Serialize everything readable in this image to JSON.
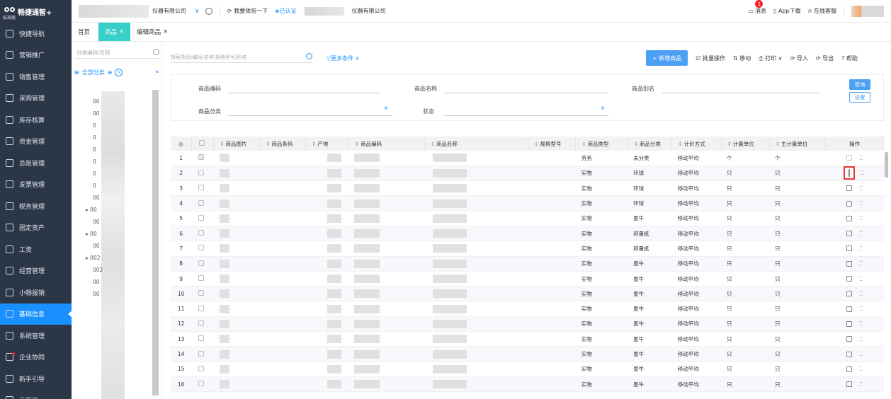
{
  "brand": {
    "name": "畅捷通智+",
    "version": "标准版"
  },
  "sidebar": {
    "items": [
      {
        "label": "快捷导航",
        "icon": "home-icon"
      },
      {
        "label": "营销推广",
        "icon": "gift-icon"
      },
      {
        "label": "销售管理",
        "icon": "sales-icon"
      },
      {
        "label": "采购管理",
        "icon": "purchase-icon"
      },
      {
        "label": "库存核算",
        "icon": "warehouse-icon"
      },
      {
        "label": "资金管理",
        "icon": "money-icon"
      },
      {
        "label": "总账管理",
        "icon": "ledger-icon"
      },
      {
        "label": "发票管理",
        "icon": "invoice-icon"
      },
      {
        "label": "税务管理",
        "icon": "tax-icon"
      },
      {
        "label": "固定资产",
        "icon": "asset-icon"
      },
      {
        "label": "工资",
        "icon": "salary-icon"
      },
      {
        "label": "经营管理",
        "icon": "business-icon"
      },
      {
        "label": "小畅报销",
        "icon": "reimburse-icon"
      },
      {
        "label": "基础信息",
        "icon": "basic-info-icon",
        "active": true
      },
      {
        "label": "系统管理",
        "icon": "system-icon"
      },
      {
        "label": "企业协同",
        "icon": "collab-icon",
        "dot": true
      },
      {
        "label": "新手引导",
        "icon": "guide-icon"
      },
      {
        "label": "云应用",
        "icon": "cloud-app-icon"
      }
    ]
  },
  "topbar": {
    "company": "仪器有限公司",
    "try_label": "我要体验一下",
    "verified_label": "已认证",
    "company2": "仪器有限公司",
    "messages_label": "消息",
    "messages_count": "1",
    "app_download": "App下载",
    "online_service": "在线客服"
  },
  "tabs": [
    {
      "label": "首页",
      "closable": ""
    },
    {
      "label": "商品",
      "closable": "×",
      "active": true
    },
    {
      "label": "编辑商品",
      "closable": "×"
    }
  ],
  "tree": {
    "search_placeholder": "分类编码/名称",
    "root_label": "全部分类",
    "collapse": "«",
    "items": [
      "00",
      "00",
      "0",
      "0",
      "0",
      "0",
      "0",
      "0",
      "00",
      "▸ 00",
      "00",
      "▸ 00",
      "00",
      "▸ 002",
      "002",
      "00",
      "00"
    ]
  },
  "main": {
    "search_placeholder": "搜索条码/编码/名称/规格型号/别名",
    "more_filters": "更多条件",
    "toolbar": {
      "new_label": "+ 新增商品",
      "batch_label": "批量操作",
      "move_label": "移动",
      "print_label": "打印",
      "import_label": "导入",
      "export_label": "导出",
      "help_label": "帮助"
    },
    "filters": {
      "code_label": "商品编码",
      "name_label": "商品名称",
      "alias_label": "商品别名",
      "category_label": "商品分类",
      "status_label": "状态",
      "query_btn": "查询",
      "settings_btn": "设置"
    }
  },
  "table": {
    "headers": [
      "商品图片",
      "商品条码",
      "产地",
      "商品编码",
      "商品名称",
      "规格型号",
      "商品类型",
      "商品分类",
      "计价方式",
      "计量单位",
      "主计量单位",
      "操作"
    ],
    "rows": [
      {
        "no": "1",
        "type": "劳务",
        "category": "未分类",
        "pricing": "移动平均",
        "unit": "个",
        "main_unit": "个"
      },
      {
        "no": "2",
        "type": "实物",
        "category": "环球",
        "pricing": "移动平均",
        "unit": "只",
        "main_unit": "只"
      },
      {
        "no": "3",
        "type": "实物",
        "category": "环球",
        "pricing": "移动平均",
        "unit": "只",
        "main_unit": "只"
      },
      {
        "no": "4",
        "type": "实物",
        "category": "环球",
        "pricing": "移动平均",
        "unit": "只",
        "main_unit": "只"
      },
      {
        "no": "5",
        "type": "实物",
        "category": "墨牛",
        "pricing": "移动平均",
        "unit": "只",
        "main_unit": "只"
      },
      {
        "no": "6",
        "type": "实物",
        "category": "称量纸",
        "pricing": "移动平均",
        "unit": "只",
        "main_unit": "只"
      },
      {
        "no": "7",
        "type": "实物",
        "category": "称量纸",
        "pricing": "移动平均",
        "unit": "只",
        "main_unit": "只"
      },
      {
        "no": "8",
        "type": "实物",
        "category": "墨牛",
        "pricing": "移动平均",
        "unit": "只",
        "main_unit": "只"
      },
      {
        "no": "9",
        "type": "实物",
        "category": "墨牛",
        "pricing": "移动平均",
        "unit": "只",
        "main_unit": "只"
      },
      {
        "no": "10",
        "type": "实物",
        "category": "墨牛",
        "pricing": "移动平均",
        "unit": "只",
        "main_unit": "只"
      },
      {
        "no": "11",
        "type": "实物",
        "category": "墨牛",
        "pricing": "移动平均",
        "unit": "只",
        "main_unit": "只"
      },
      {
        "no": "12",
        "type": "实物",
        "category": "墨牛",
        "pricing": "移动平均",
        "unit": "只",
        "main_unit": "只"
      },
      {
        "no": "13",
        "type": "实物",
        "category": "墨牛",
        "pricing": "移动平均",
        "unit": "只",
        "main_unit": "只"
      },
      {
        "no": "14",
        "type": "实物",
        "category": "墨牛",
        "pricing": "移动平均",
        "unit": "只",
        "main_unit": "只"
      },
      {
        "no": "15",
        "type": "实物",
        "category": "墨牛",
        "pricing": "移动平均",
        "unit": "只",
        "main_unit": "只"
      },
      {
        "no": "16",
        "type": "实物",
        "category": "墨牛",
        "pricing": "移动平均",
        "unit": "只",
        "main_unit": "只"
      }
    ],
    "op_copy": "⁚⁚"
  },
  "colors": {
    "sidebar": "#2b3647",
    "active": "#1890ff",
    "tab_active": "#36cfc9",
    "highlight": "#e53935"
  }
}
